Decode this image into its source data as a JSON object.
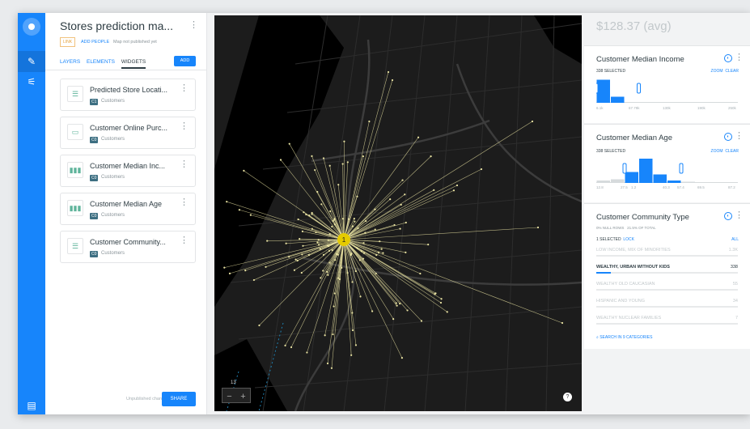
{
  "header": {
    "title": "Stores prediction ma...",
    "privacy": "LINK",
    "add_people": "ADD PEOPLE",
    "publish_status": "Map not published yet"
  },
  "tabs": {
    "layers": "LAYERS",
    "elements": "ELEMENTS",
    "widgets": "WIDGETS",
    "add": "ADD"
  },
  "widgets": [
    {
      "name": "Predicted Store Locati...",
      "badge": "C1",
      "source": "Customers"
    },
    {
      "name": "Customer Online Purc...",
      "badge": "C0",
      "source": "Customers"
    },
    {
      "name": "Customer Median Inc...",
      "badge": "C0",
      "source": "Customers"
    },
    {
      "name": "Customer Median Age",
      "badge": "C0",
      "source": "Customers"
    },
    {
      "name": "Customer Community...",
      "badge": "C0",
      "source": "Customers"
    }
  ],
  "footer": {
    "unpublished": "Unpublished changes",
    "share": "SHARE"
  },
  "map": {
    "zoom_level": "13",
    "zoom_in": "+",
    "zoom_out": "−",
    "cluster_count": "1",
    "info": "?"
  },
  "right": {
    "avg": "$128.37 (avg)",
    "income": {
      "title": "Customer Median Income",
      "selected": "338 SELECTED",
      "zoom": "ZOOM",
      "clear": "CLEAR",
      "ticks": [
        "6.1k",
        "67.79k",
        "130k",
        "190k",
        "250k"
      ],
      "bins": [
        0.95,
        0.25,
        0,
        0,
        0,
        0,
        0,
        0,
        0,
        0
      ]
    },
    "age": {
      "title": "Customer Median Age",
      "selected": "338 SELECTED",
      "zoom": "ZOOM",
      "clear": "CLEAR",
      "ticks": [
        "12.8",
        "27.5",
        "1.2",
        "40.3",
        "57.4",
        "69.5",
        "87.2"
      ],
      "bins": [
        0.1,
        0.15,
        0.45,
        1.0,
        0.35,
        0.1,
        0.05,
        0,
        0,
        0
      ]
    },
    "community": {
      "title": "Customer Community Type",
      "null_rows": "0% NULL ROWS",
      "of_total": "21.5% OF TOTAL",
      "selected": "1 SELECTED",
      "lock": "LOCK",
      "all": "ALL",
      "categories": [
        {
          "label": "LOW INCOME, MIX OF MINORITIES",
          "count": "1.3K",
          "selected": false
        },
        {
          "label": "WEALTHY, URBAN WITHOUT KIDS",
          "count": "338",
          "selected": true
        },
        {
          "label": "WEALTHY OLD CAUCASIAN",
          "count": "55",
          "selected": false
        },
        {
          "label": "HISPANIC AND YOUNG",
          "count": "34",
          "selected": false
        },
        {
          "label": "WEALTHY NUCLEAR FAMILIES",
          "count": "7",
          "selected": false
        }
      ],
      "search": "SEARCH IN 9 CATEGORIES"
    }
  },
  "colors": {
    "accent": "#1785fb",
    "cluster": "#e5cb00",
    "spoke": "#e9e3a2"
  }
}
